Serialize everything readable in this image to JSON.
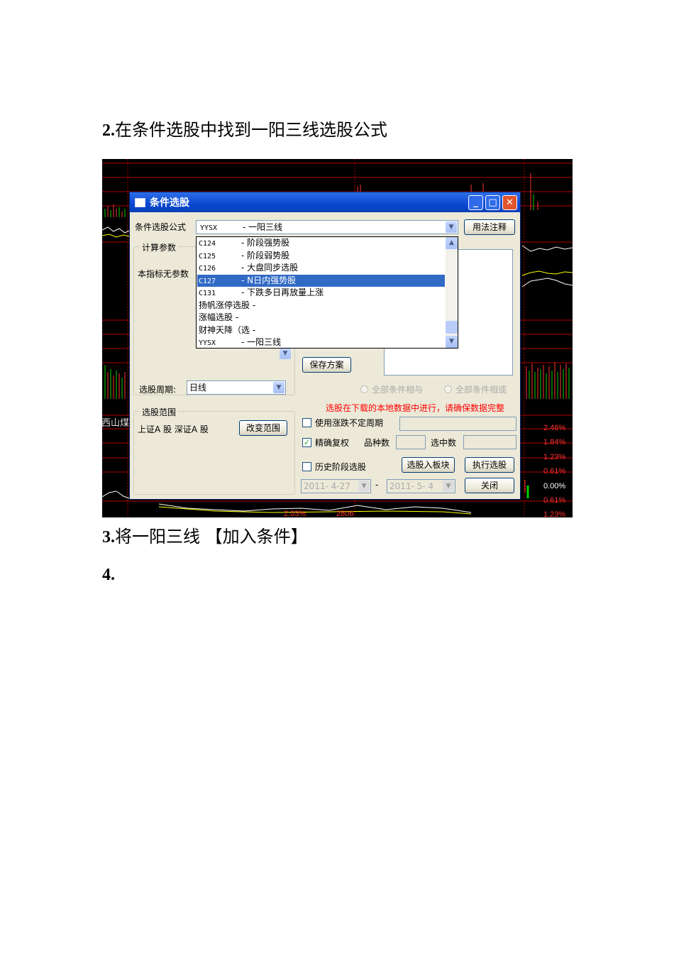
{
  "doc": {
    "step2": {
      "num": "2.",
      "text": "在条件选股中找到一阳三线选股公式"
    },
    "step3": {
      "num": "3.",
      "text": "将一阳三线 【加入条件】"
    },
    "step4": {
      "num": "4."
    }
  },
  "background_chart": {
    "stock_name": "西山煤",
    "percent_labels": [
      "2.46%",
      "1.84%",
      "1.23%",
      "0.61%",
      "0.00%",
      "0.61%",
      "1.23%"
    ],
    "bottom_numbers": [
      "2.03%",
      "2806"
    ],
    "colors": {
      "grid": "#b00000",
      "up": "#ff3333",
      "down": "#00d000",
      "line": "#ffffff",
      "avg": "#ffff00"
    }
  },
  "dialog": {
    "title": "条件选股",
    "formula_label": "条件选股公式",
    "formula_value_code": "YYSX",
    "formula_value_name": "- 一阳三线",
    "usage_button": "用法注释",
    "params_group_title": "计算参数",
    "params_text": "本指标无参数",
    "dropdown_items": [
      {
        "code": "C124",
        "name": "- 阶段强势股",
        "selected": false
      },
      {
        "code": "C125",
        "name": "- 阶段弱势股",
        "selected": false
      },
      {
        "code": "C126",
        "name": "- 大盘同步选股",
        "selected": false
      },
      {
        "code": "C127",
        "name": "- N日内强势股",
        "selected": true
      },
      {
        "code": "C131",
        "name": "- 下跌多日再放量上涨",
        "selected": false
      },
      {
        "code": "",
        "name": "扬帆涨停选股 -",
        "selected": false
      },
      {
        "code": "",
        "name": "涨幅选股 -",
        "selected": false
      },
      {
        "code": "",
        "name": "财神天降（选 -",
        "selected": false
      },
      {
        "code": "YYSX",
        "name": "- 一阳三线",
        "selected": false
      }
    ],
    "save_plan_button": "保存方案",
    "period_label": "选股周期:",
    "period_value": "日线",
    "radio_and": "全部条件相与",
    "radio_or": "全部条件相或",
    "warning_text": "选股在下载的本地数据中进行，请确保数据完整",
    "range_group_title": "选股范围",
    "range_text": "上证A 股  深证A 股",
    "change_range_button": "改变范围",
    "uncertain_period_label": "使用涨跌不定周期",
    "precise_rights_label": "精确复权",
    "precise_rights_checked": true,
    "variety_count_label": "品种数",
    "selected_count_label": "选中数",
    "history_label": "历史阶段选股",
    "date_from": "2011- 4-27",
    "date_to": "2011- 5- 4",
    "date_separator": "-",
    "add_to_block_button": "选股入板块",
    "execute_button": "执行选股",
    "close_button": "关闭"
  }
}
